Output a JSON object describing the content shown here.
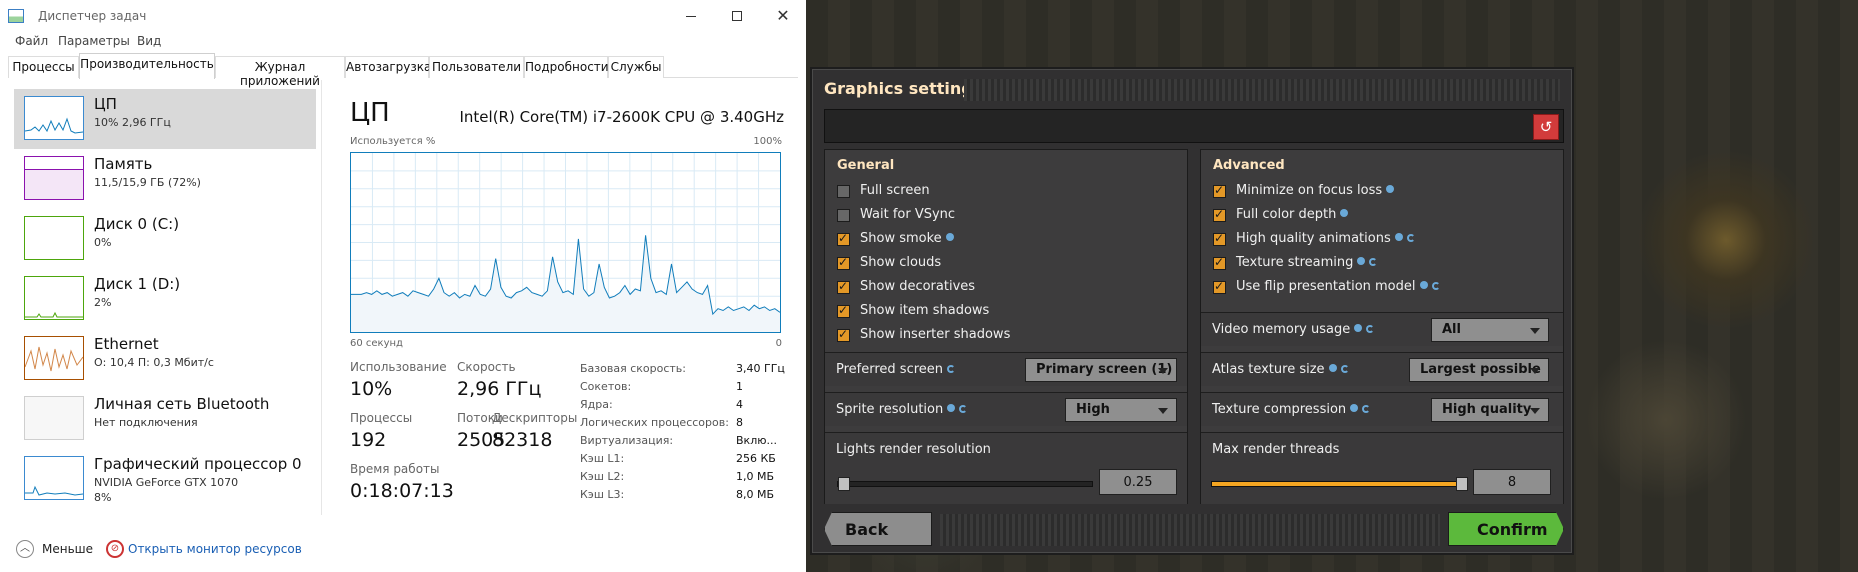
{
  "task_manager": {
    "window_title": "Диспетчер задач",
    "menu": [
      "Файл",
      "Параметры",
      "Вид"
    ],
    "tabs": [
      "Процессы",
      "Производительность",
      "Журнал приложений",
      "Автозагрузка",
      "Пользователи",
      "Подробности",
      "Службы"
    ],
    "active_tab": "Производительность",
    "sidebar": [
      {
        "name": "ЦП",
        "sub": "10% 2,96 ГГц",
        "color": "#117dbb"
      },
      {
        "name": "Память",
        "sub": "11,5/15,9 ГБ (72%)",
        "color": "#8b12ae"
      },
      {
        "name": "Диск 0 (C:)",
        "sub": "0%",
        "color": "#4da60c"
      },
      {
        "name": "Диск 1 (D:)",
        "sub": "2%",
        "color": "#4da60c"
      },
      {
        "name": "Ethernet",
        "sub": "О: 10,4 П: 0,3 Мбит/с",
        "color": "#a74f01"
      },
      {
        "name": "Личная сеть Bluetooth",
        "sub": "Нет подключения",
        "color": "#cccccc"
      },
      {
        "name": "Графический процессор 0",
        "sub": "NVIDIA GeForce GTX 1070",
        "sub2": "8%",
        "color": "#117dbb"
      }
    ],
    "main": {
      "title": "ЦП",
      "model": "Intel(R) Core(TM) i7-2600K CPU @ 3.40GHz",
      "graph_top_left": "Используется %",
      "graph_top_right": "100%",
      "graph_bottom_left": "60 секунд",
      "graph_bottom_right": "0",
      "cpu_history": [
        21,
        21,
        21,
        22,
        21,
        23,
        21,
        22,
        20,
        21,
        22,
        20,
        23,
        22,
        21,
        20,
        24,
        30,
        22,
        20,
        22,
        19,
        21,
        20,
        26,
        21,
        20,
        24,
        41,
        25,
        20,
        19,
        22,
        23,
        25,
        22,
        21,
        20,
        23,
        42,
        28,
        22,
        23,
        21,
        52,
        24,
        20,
        22,
        38,
        25,
        19,
        20,
        22,
        26,
        21,
        24,
        23,
        54,
        30,
        22,
        23,
        21,
        38,
        22,
        25,
        28,
        24,
        22,
        21,
        26,
        10,
        13,
        12,
        14,
        12,
        13,
        14,
        12,
        15,
        13,
        14,
        12,
        13,
        11
      ],
      "stats": {
        "usage_label": "Использование",
        "usage_value": "10%",
        "speed_label": "Скорость",
        "speed_value": "2,96 ГГц",
        "processes_label": "Процессы",
        "processes_value": "192",
        "threads_label": "Потоки",
        "threads_value": "2505",
        "handles_label": "Дескрипторы",
        "handles_value": "82318",
        "uptime_label": "Время работы",
        "uptime_value": "0:18:07:13"
      },
      "details": [
        {
          "label": "Базовая скорость:",
          "value": "3,40 ГГц"
        },
        {
          "label": "Сокетов:",
          "value": "1"
        },
        {
          "label": "Ядра:",
          "value": "4"
        },
        {
          "label": "Логических процессоров:",
          "value": "8"
        },
        {
          "label": "Виртуализация:",
          "value": "Вклю..."
        },
        {
          "label": "Кэш L1:",
          "value": "256 КБ"
        },
        {
          "label": "Кэш L2:",
          "value": "1,0 МБ"
        },
        {
          "label": "Кэш L3:",
          "value": "8,0 МБ"
        }
      ]
    },
    "footer": {
      "less_label": "Меньше",
      "monitor_label": "Открыть монитор ресурсов"
    }
  },
  "graphics": {
    "title": "Graphics settings",
    "general_title": "General",
    "general_checks": [
      {
        "label": "Full screen",
        "checked": false
      },
      {
        "label": "Wait for VSync",
        "checked": false
      },
      {
        "label": "Show smoke",
        "checked": true,
        "info": true
      },
      {
        "label": "Show clouds",
        "checked": true
      },
      {
        "label": "Show decoratives",
        "checked": true
      },
      {
        "label": "Show item shadows",
        "checked": true
      },
      {
        "label": "Show inserter shadows",
        "checked": true
      }
    ],
    "advanced_title": "Advanced",
    "advanced_checks": [
      {
        "label": "Minimize on focus loss",
        "checked": true,
        "info": true
      },
      {
        "label": "Full color depth",
        "checked": true,
        "info": true
      },
      {
        "label": "High quality animations",
        "checked": true,
        "info": true,
        "refresh": true
      },
      {
        "label": "Texture streaming",
        "checked": true,
        "info": true,
        "refresh": true
      },
      {
        "label": "Use flip presentation model",
        "checked": true,
        "info": true,
        "refresh": true
      }
    ],
    "preferred_screen_label": "Preferred screen",
    "preferred_screen_value": "Primary screen (1)",
    "sprite_resolution_label": "Sprite resolution",
    "sprite_resolution_value": "High",
    "lights_label": "Lights render resolution",
    "lights_value": "0.25",
    "lights_fraction": 0.0,
    "video_memory_label": "Video memory usage",
    "video_memory_value": "All",
    "atlas_label": "Atlas texture size",
    "atlas_value": "Largest possible",
    "compression_label": "Texture compression",
    "compression_value": "High quality",
    "threads_label": "Max render threads",
    "threads_value": "8",
    "threads_fraction": 1.0,
    "back_label": "Back",
    "confirm_label": "Confirm",
    "colors": {
      "accent": "#f5a622",
      "confirm": "#5cb93c",
      "reset": "#d23b3b",
      "title": "#ffe6c0"
    }
  }
}
